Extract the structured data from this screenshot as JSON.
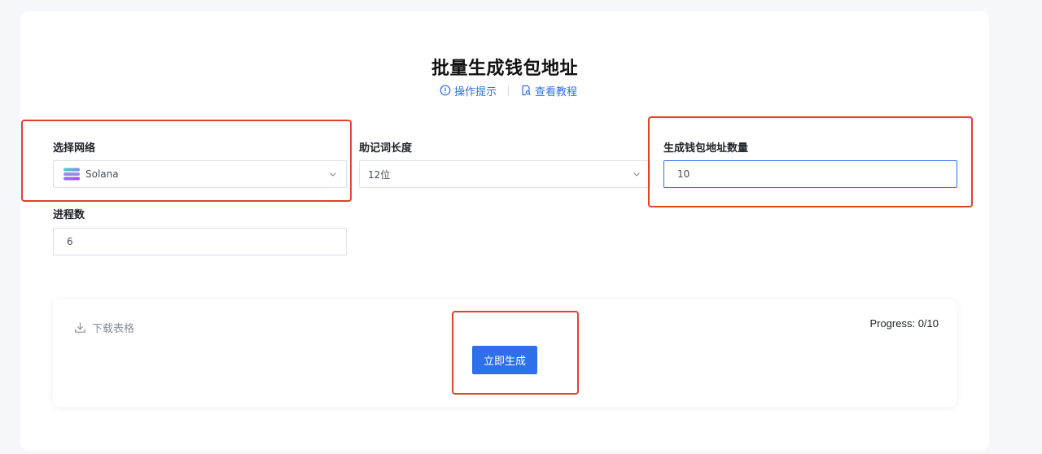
{
  "page": {
    "title": "批量生成钱包地址",
    "links": {
      "tips": "操作提示",
      "tutorial": "查看教程"
    }
  },
  "form": {
    "network": {
      "label": "选择网络",
      "value": "Solana",
      "icon": "solana-logo"
    },
    "mnemonic_length": {
      "label": "助记词长度",
      "value": "12位"
    },
    "address_count": {
      "label": "生成钱包地址数量",
      "value": "10"
    },
    "threads": {
      "label": "进程数",
      "value": "6"
    }
  },
  "actions": {
    "download_label": "下载表格",
    "generate_label": "立即生成",
    "progress_text": "Progress: 0/10"
  },
  "colors": {
    "accent": "#2f6fea",
    "highlight": "#e5402a",
    "background": "#f5f7fb"
  }
}
